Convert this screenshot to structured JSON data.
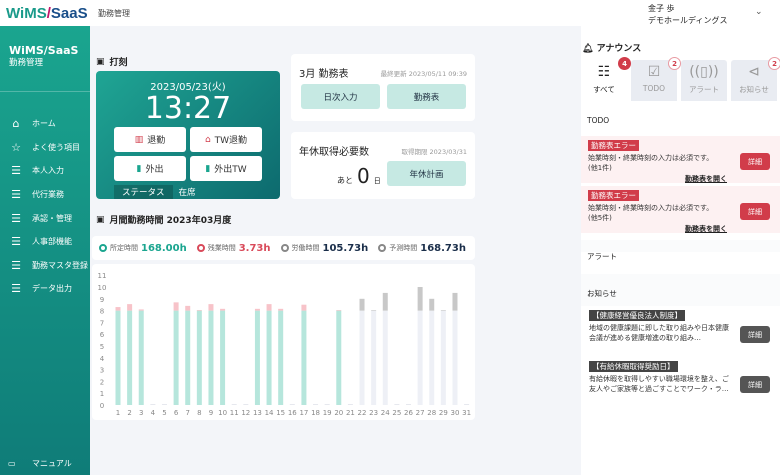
{
  "app": {
    "logo_a": "WiMS",
    "logo_sep": "/",
    "logo_b": "SaaS",
    "header_title": "勤務管理",
    "user_name": "金子 歩",
    "company": "デモホールディングス"
  },
  "sidebar": {
    "title": "WiMS/SaaS",
    "subtitle": "勤務管理",
    "items": [
      {
        "label": "ホーム",
        "icon": "home-icon"
      },
      {
        "label": "よく使う項目",
        "icon": "star-icon"
      },
      {
        "label": "本人入力",
        "icon": "list-icon"
      },
      {
        "label": "代行業務",
        "icon": "list-icon"
      },
      {
        "label": "承認・管理",
        "icon": "list-icon"
      },
      {
        "label": "人事部機能",
        "icon": "list-icon"
      },
      {
        "label": "勤務マスタ登録",
        "icon": "list-icon"
      },
      {
        "label": "データ出力",
        "icon": "list-icon"
      }
    ],
    "manual": "マニュアル"
  },
  "punch": {
    "title": "打刻",
    "date": "2023/05/23(火)",
    "time": "13:27",
    "buttons": [
      "退勤",
      "TW退勤",
      "外出",
      "外出TW"
    ],
    "status_label": "ステータス",
    "status_value": "在席"
  },
  "timesheet": {
    "title": "3月 勤務表",
    "note": "最終更新 2023/05/11 09:39",
    "btn_daily": "日次入力",
    "btn_sheet": "勤務表"
  },
  "leave": {
    "title": "年休取得必要数",
    "note": "取得期限 2023/03/31",
    "prefix": "あと",
    "count": "0",
    "unit": "日",
    "btn": "年休計画"
  },
  "monthly": {
    "title": "月間勤務時間 2023年03月度",
    "legend": [
      {
        "label": "所定時間",
        "value": "168.00h",
        "color": "#1aa58f"
      },
      {
        "label": "残業時間",
        "value": "3.73h",
        "color": "#d94a5a"
      },
      {
        "label": "労働時間",
        "value": "105.73h",
        "color": "#888888"
      },
      {
        "label": "予測時間",
        "value": "168.73h",
        "color": "#888888"
      }
    ]
  },
  "chart_data": {
    "type": "bar",
    "stacked": true,
    "categories": [
      "1",
      "2",
      "3",
      "4",
      "5",
      "6",
      "7",
      "8",
      "9",
      "10",
      "11",
      "12",
      "13",
      "14",
      "15",
      "16",
      "17",
      "18",
      "19",
      "20",
      "21",
      "22",
      "23",
      "24",
      "25",
      "26",
      "27",
      "28",
      "29",
      "30",
      "31"
    ],
    "ylim": [
      0,
      11
    ],
    "yticks": [
      0,
      1,
      2,
      3,
      4,
      5,
      6,
      7,
      8,
      9,
      10,
      11
    ],
    "series": [
      {
        "key": "regular",
        "color": "#b6e6dc",
        "values": [
          8,
          8,
          8,
          0,
          0,
          8,
          8,
          8,
          8,
          8,
          0,
          0,
          8,
          8,
          8,
          0,
          8,
          0,
          0,
          8,
          0,
          0,
          0,
          0,
          0,
          0,
          0,
          0,
          0,
          0,
          0
        ]
      },
      {
        "key": "overtime",
        "color": "#f7c3c9",
        "values": [
          0.3,
          0.55,
          0.1,
          0,
          0,
          0.7,
          0.4,
          0.05,
          0.55,
          0.15,
          0,
          0,
          0.15,
          0.55,
          0.15,
          0,
          0.5,
          0,
          0,
          0.05,
          0,
          0,
          0,
          0,
          0,
          0,
          0,
          0,
          0,
          0,
          0
        ]
      },
      {
        "key": "forecast_regular",
        "color": "#eef0f6",
        "values": [
          0,
          0,
          0,
          0,
          0,
          0,
          0,
          0,
          0,
          0,
          0,
          0,
          0,
          0,
          0,
          0,
          0,
          0,
          0,
          0,
          0,
          8,
          8,
          8,
          0,
          0,
          8,
          8,
          8,
          8,
          0
        ]
      },
      {
        "key": "forecast_extra",
        "color": "#c8c8c8",
        "values": [
          0,
          0,
          0,
          0,
          0,
          0,
          0,
          0,
          0,
          0,
          0,
          0,
          0,
          0,
          0,
          0,
          0,
          0,
          0,
          0,
          0,
          1,
          0.05,
          1.5,
          0,
          0,
          2,
          1,
          0.05,
          1.5,
          0
        ]
      }
    ]
  },
  "announce": {
    "title": "アナウンス",
    "tabs": [
      {
        "label": "すべて",
        "badge": "4",
        "icon": "checklist-icon"
      },
      {
        "label": "TODO",
        "badge": "2",
        "icon": "calendar-check-icon"
      },
      {
        "label": "アラート",
        "badge": "",
        "icon": "vibrate-icon"
      },
      {
        "label": "お知らせ",
        "badge": "2",
        "icon": "megaphone-icon"
      }
    ],
    "todo_header": "TODO",
    "todos": [
      {
        "tag": "勤務表エラー",
        "msg": "始業時刻・終業時刻の入力は必須です。",
        "count": "(他1件)",
        "link": "勤務表を開く",
        "btn": "詳細"
      },
      {
        "tag": "勤務表エラー",
        "msg": "始業時刻・終業時刻の入力は必須です。",
        "count": "(他5件)",
        "link": "勤務表を開く",
        "btn": "詳細"
      }
    ],
    "alert_header": "アラート",
    "news_header": "お知らせ",
    "news": [
      {
        "tag": "【健康経営優良法人制度】",
        "msg": "地域の健康課題に即した取り組みや日本健康会議が進める健康増進の取り組み…",
        "btn": "詳細"
      },
      {
        "tag": "【有給休暇取得奨励日】",
        "msg": "有給休暇を取得しやすい職場環境を整え、ご友人やご家族等と過ごすことでワーク・ラ…",
        "btn": "詳細"
      }
    ]
  }
}
